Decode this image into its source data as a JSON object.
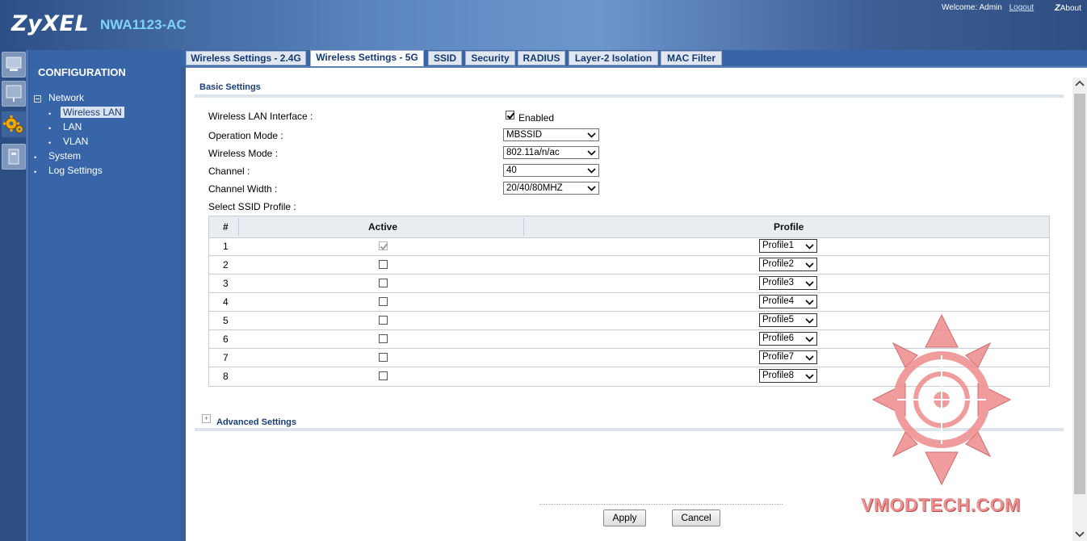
{
  "header": {
    "brand": "ZyXEL",
    "model": "NWA1123-AC",
    "welcome": "Welcome: Admin",
    "logout": "Logout",
    "about": "About"
  },
  "nav": {
    "title": "CONFIGURATION",
    "items": [
      {
        "label": "Network"
      },
      {
        "label": "Wireless LAN"
      },
      {
        "label": "LAN"
      },
      {
        "label": "VLAN"
      },
      {
        "label": "System"
      },
      {
        "label": "Log Settings"
      }
    ]
  },
  "tabs": [
    {
      "label": "Wireless Settings - 2.4G"
    },
    {
      "label": "Wireless Settings - 5G"
    },
    {
      "label": "SSID"
    },
    {
      "label": "Security"
    },
    {
      "label": "RADIUS"
    },
    {
      "label": "Layer-2 Isolation"
    },
    {
      "label": "MAC Filter"
    }
  ],
  "basic": {
    "title": "Basic Settings",
    "interface_label": "Wireless LAN Interface :",
    "enabled_label": "Enabled",
    "operation_mode_label": "Operation Mode :",
    "operation_mode": "MBSSID",
    "wireless_mode_label": "Wireless Mode :",
    "wireless_mode": "802.11a/n/ac",
    "channel_label": "Channel :",
    "channel": "40",
    "channel_width_label": "Channel Width :",
    "channel_width": "20/40/80MHZ",
    "ssid_profile_label": "Select SSID Profile :"
  },
  "table": {
    "headers": [
      "#",
      "Active",
      "Profile"
    ],
    "rows": [
      {
        "num": "1",
        "profile": "Profile1",
        "active": true
      },
      {
        "num": "2",
        "profile": "Profile2",
        "active": false
      },
      {
        "num": "3",
        "profile": "Profile3",
        "active": false
      },
      {
        "num": "4",
        "profile": "Profile4",
        "active": false
      },
      {
        "num": "5",
        "profile": "Profile5",
        "active": false
      },
      {
        "num": "6",
        "profile": "Profile6",
        "active": false
      },
      {
        "num": "7",
        "profile": "Profile7",
        "active": false
      },
      {
        "num": "8",
        "profile": "Profile8",
        "active": false
      }
    ]
  },
  "advanced": {
    "title": "Advanced Settings"
  },
  "buttons": {
    "apply": "Apply",
    "cancel": "Cancel"
  },
  "watermark": {
    "text": "VMODTECH.COM"
  }
}
